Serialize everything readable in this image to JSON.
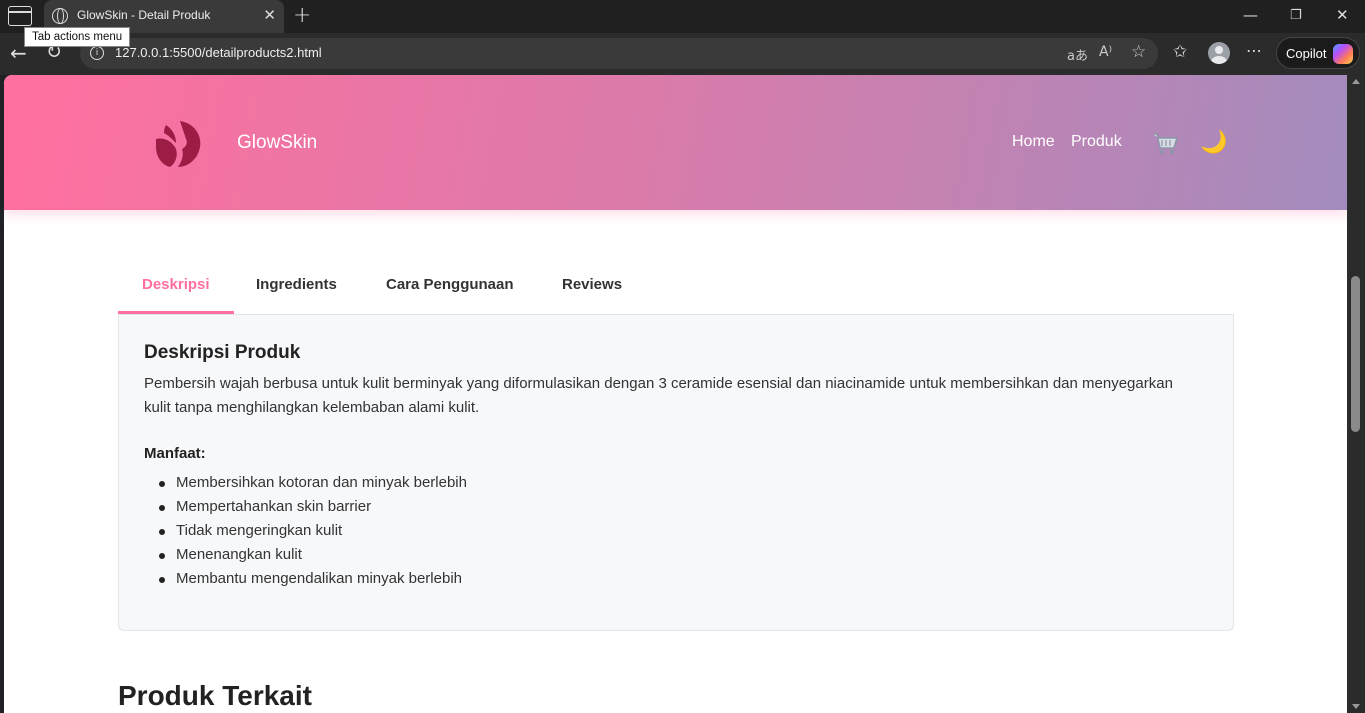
{
  "browser": {
    "tab_title": "GlowSkin - Detail Produk",
    "tooltip": "Tab actions menu",
    "url": "127.0.0.1:5500/detailproducts2.html",
    "copilot_label": "Copilot"
  },
  "header": {
    "brand": "GlowSkin",
    "nav": [
      "Home",
      "Produk"
    ]
  },
  "tabs": [
    "Deskripsi",
    "Ingredients",
    "Cara Penggunaan",
    "Reviews"
  ],
  "active_tab": "Deskripsi",
  "description": {
    "title": "Deskripsi Produk",
    "text": "Pembersih wajah berbusa untuk kulit berminyak yang diformulasikan dengan 3 ceramide esensial dan niacinamide untuk membersihkan dan menyegarkan kulit tanpa menghilangkan kelembaban alami kulit.",
    "benefits_label": "Manfaat:",
    "benefits": [
      "Membersihkan kotoran dan minyak berlebih",
      "Mempertahankan skin barrier",
      "Tidak mengeringkan kulit",
      "Menenangkan kulit",
      "Membantu mengendalikan minyak berlebih"
    ]
  },
  "related_title": "Produk Terkait",
  "colors": {
    "accent": "#ff6f9f",
    "header_gradient_start": "#ff6f9f",
    "header_gradient_end": "#a38cbd"
  }
}
